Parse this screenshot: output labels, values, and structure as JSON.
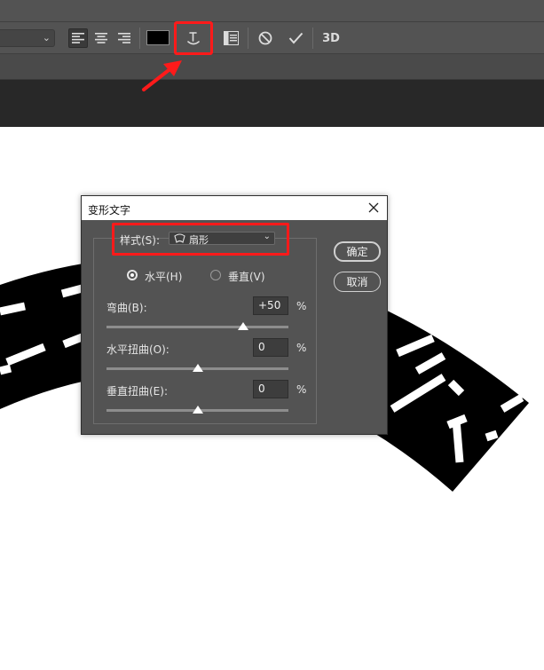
{
  "dialog": {
    "title": "变形文字",
    "style_label": "样式(S):",
    "style_value": "扇形",
    "orientation": {
      "horizontal_label": "水平(H)",
      "vertical_label": "垂直(V)",
      "selected": "horizontal"
    },
    "bend": {
      "label": "弯曲(B):",
      "value": "+50",
      "unit": "%",
      "slider_fraction": 0.75
    },
    "h_distortion": {
      "label": "水平扭曲(O):",
      "value": "0",
      "unit": "%",
      "slider_fraction": 0.5
    },
    "v_distortion": {
      "label": "垂直扭曲(E):",
      "value": "0",
      "unit": "%",
      "slider_fraction": 0.5
    },
    "ok_label": "确定",
    "cancel_label": "取消"
  },
  "toolbar": {
    "text_color": "#000000",
    "three_d_label": "3D",
    "icons": [
      "align-left-icon",
      "align-center-icon",
      "align-right-icon",
      "warp-text-icon",
      "character-panel-icon",
      "cancel-icon",
      "commit-icon"
    ]
  },
  "colors": {
    "annotation": "#ff1a1a",
    "dialog_bg": "#535353",
    "toolbar_bg": "#535353"
  }
}
